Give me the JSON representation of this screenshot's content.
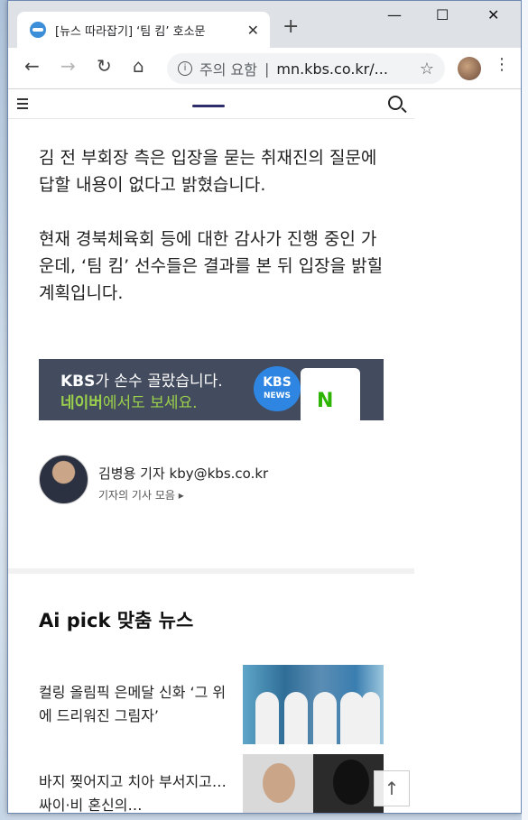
{
  "browser": {
    "tab_title": "[뉴스 따라잡기] ‘팀 킴’ 호소문",
    "url_warning": "주의 요함",
    "url": "mn.kbs.co.kr/...",
    "new_tab": "+",
    "close_tab": "✕"
  },
  "window_controls": {
    "minimize": "—",
    "maximize": "☐",
    "close": "✕"
  },
  "article": {
    "para1": "김 전 부회장 측은 입장을 묻는 취재진의 질문에 답할 내용이 없다고 밝혔습니다.",
    "para2": "현재 경북체육회 등에 대한 감사가 진행 중인 가운데, ‘팀 킴’ 선수들은 결과를 본 뒤 입장을 밝힐 계획입니다."
  },
  "banner": {
    "line1_brand": "KBS",
    "line1_rest": "가 손수 골랐습니다.",
    "line2_brand": "네이버",
    "line2_rest": "에서도 보세요.",
    "logo_main": "KBS",
    "logo_sub": "NEWS",
    "naver_letter": "N"
  },
  "reporter": {
    "name": "김병용 기자 kby@kbs.co.kr",
    "more": "기자의 기사 모음 ▸"
  },
  "section_title": "Ai pick 맞춤 뉴스",
  "news": [
    {
      "title": "컬링 올림픽 은메달 신화 ‘그 위에 드리워진 그림자’"
    },
    {
      "title": "바지 찢어지고 치아 부서지고…싸이·비 혼신의…"
    }
  ],
  "to_top": "↑"
}
